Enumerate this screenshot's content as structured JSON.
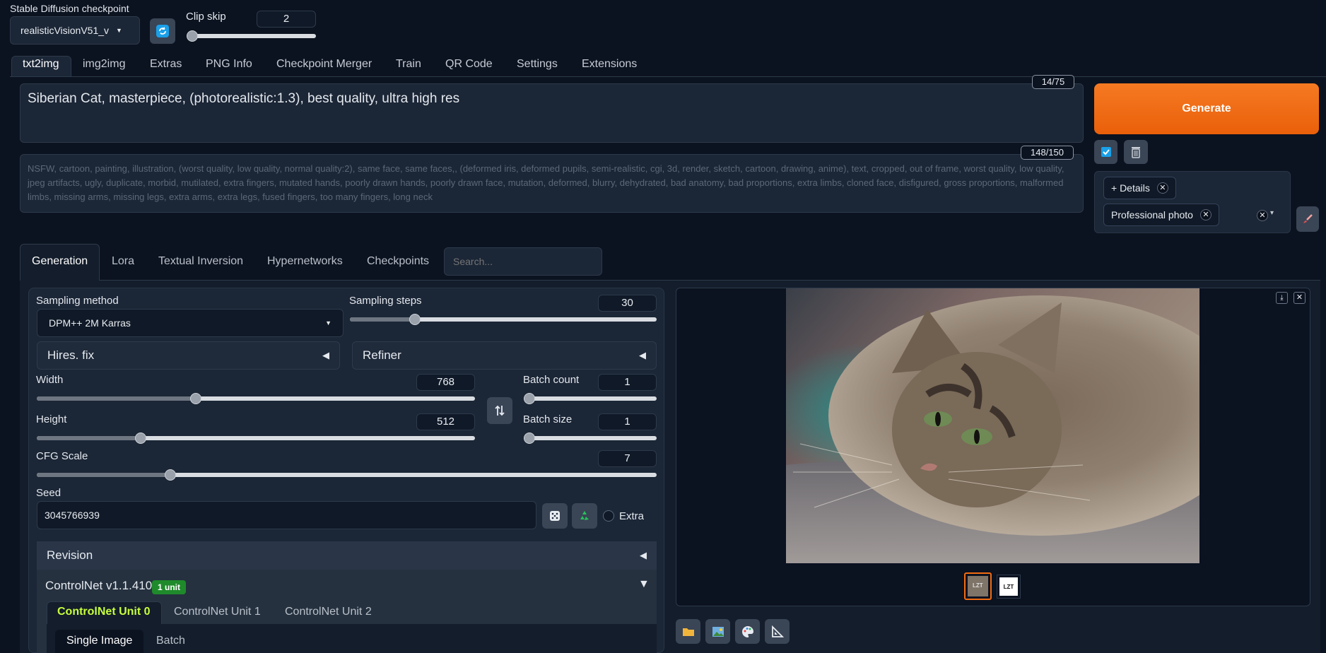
{
  "checkpoint": {
    "label": "Stable Diffusion checkpoint",
    "value": "realisticVisionV51_v"
  },
  "clip_skip": {
    "label": "Clip skip",
    "value": "2",
    "fraction": 0.0
  },
  "tabs": [
    "txt2img",
    "img2img",
    "Extras",
    "PNG Info",
    "Checkpoint Merger",
    "Train",
    "QR Code",
    "Settings",
    "Extensions"
  ],
  "prompt": {
    "text": "Siberian Cat, masterpiece, (photorealistic:1.3), best quality, ultra high res",
    "counter": "14/75"
  },
  "negative": {
    "text": "NSFW, cartoon, painting, illustration, (worst quality, low quality, normal quality:2), same face, same faces,, (deformed iris, deformed pupils, semi-realistic, cgi, 3d, render, sketch, cartoon, drawing, anime), text, cropped, out of frame, worst quality, low quality, jpeg artifacts, ugly, duplicate, morbid, mutilated, extra fingers, mutated hands, poorly drawn hands, poorly drawn face, mutation, deformed, blurry, dehydrated, bad anatomy, bad proportions, extra limbs, cloned face, disfigured, gross proportions, malformed limbs, missing arms, missing legs, extra arms, extra legs, fused fingers, too many fingers, long neck",
    "counter": "148/150"
  },
  "generate_label": "Generate",
  "styles": {
    "items": [
      "+ Details",
      "Professional photo"
    ]
  },
  "subtabs": [
    "Generation",
    "Lora",
    "Textual Inversion",
    "Hypernetworks",
    "Checkpoints"
  ],
  "search_placeholder": "Search...",
  "sampling": {
    "method_label": "Sampling method",
    "method_value": "DPM++ 2M Karras",
    "steps_label": "Sampling steps",
    "steps_value": "30",
    "steps_fraction": 0.2
  },
  "hires_label": "Hires. fix",
  "refiner_label": "Refiner",
  "width": {
    "label": "Width",
    "value": "768",
    "fraction": 0.36
  },
  "height": {
    "label": "Height",
    "value": "512",
    "fraction": 0.23
  },
  "batch_count": {
    "label": "Batch count",
    "value": "1",
    "fraction": 0.0
  },
  "batch_size": {
    "label": "Batch size",
    "value": "1",
    "fraction": 0.0
  },
  "cfg": {
    "label": "CFG Scale",
    "value": "7",
    "fraction": 0.21
  },
  "seed": {
    "label": "Seed",
    "value": "3045766939",
    "extra_label": "Extra"
  },
  "revision_label": "Revision",
  "controlnet": {
    "title": "ControlNet v1.1.410",
    "badge": "1 unit",
    "units": [
      "ControlNet Unit 0",
      "ControlNet Unit 1",
      "ControlNet Unit 2"
    ],
    "modes": [
      "Single Image",
      "Batch"
    ]
  },
  "thumb_text": "LZT",
  "colors": {
    "accent": "#f26b12",
    "badge": "#1f8a2b",
    "unit_active": "#c7ff3d"
  }
}
